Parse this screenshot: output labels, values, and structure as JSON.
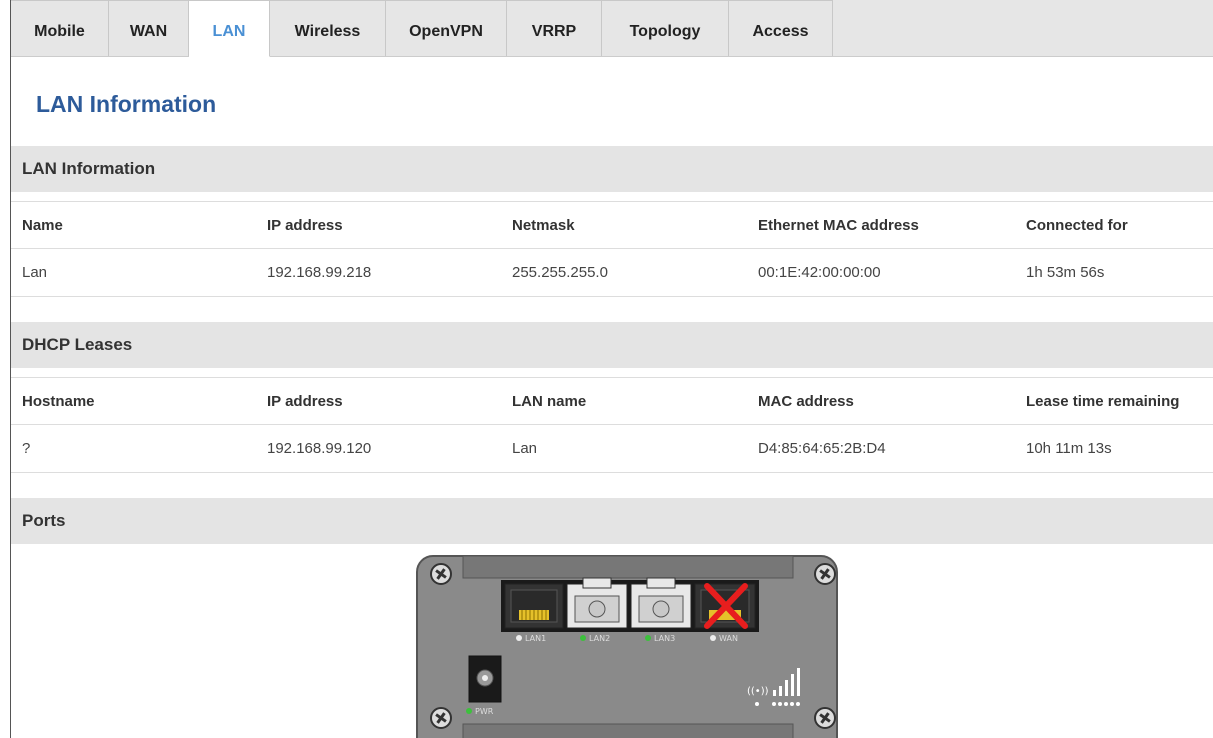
{
  "tabs": [
    {
      "label": "Mobile",
      "active": false
    },
    {
      "label": "WAN",
      "active": false
    },
    {
      "label": "LAN",
      "active": true
    },
    {
      "label": "Wireless",
      "active": false
    },
    {
      "label": "OpenVPN",
      "active": false
    },
    {
      "label": "VRRP",
      "active": false
    },
    {
      "label": "Topology",
      "active": false
    },
    {
      "label": "Access",
      "active": false
    }
  ],
  "page_title": "LAN Information",
  "lan_section": {
    "title": "LAN Information",
    "headers": [
      "Name",
      "IP address",
      "Netmask",
      "Ethernet MAC address",
      "Connected for"
    ],
    "rows": [
      [
        "Lan",
        "192.168.99.218",
        "255.255.255.0",
        "00:1E:42:00:00:00",
        "1h 53m 56s"
      ]
    ]
  },
  "dhcp_section": {
    "title": "DHCP Leases",
    "headers": [
      "Hostname",
      "IP address",
      "LAN name",
      "MAC address",
      "Lease time remaining"
    ],
    "rows": [
      [
        "?",
        "192.168.99.120",
        "Lan",
        "D4:85:64:65:2B:D4",
        "10h 11m 13s"
      ]
    ]
  },
  "ports_section": {
    "title": "Ports",
    "ports": [
      {
        "label": "LAN1",
        "type": "rj45",
        "led": "off",
        "disabled": false
      },
      {
        "label": "LAN2",
        "type": "fiber",
        "led": "green",
        "disabled": false
      },
      {
        "label": "LAN3",
        "type": "fiber",
        "led": "green",
        "disabled": false
      },
      {
        "label": "WAN",
        "type": "rj45",
        "led": "off",
        "disabled": true
      }
    ],
    "power_label": "PWR",
    "power_led": "green"
  },
  "colors": {
    "accent": "#4a90d4",
    "title": "#2d5b9a",
    "led_green": "#3cc13c",
    "disabled_x": "#e81e1e",
    "device_body": "#8a8a8a"
  }
}
